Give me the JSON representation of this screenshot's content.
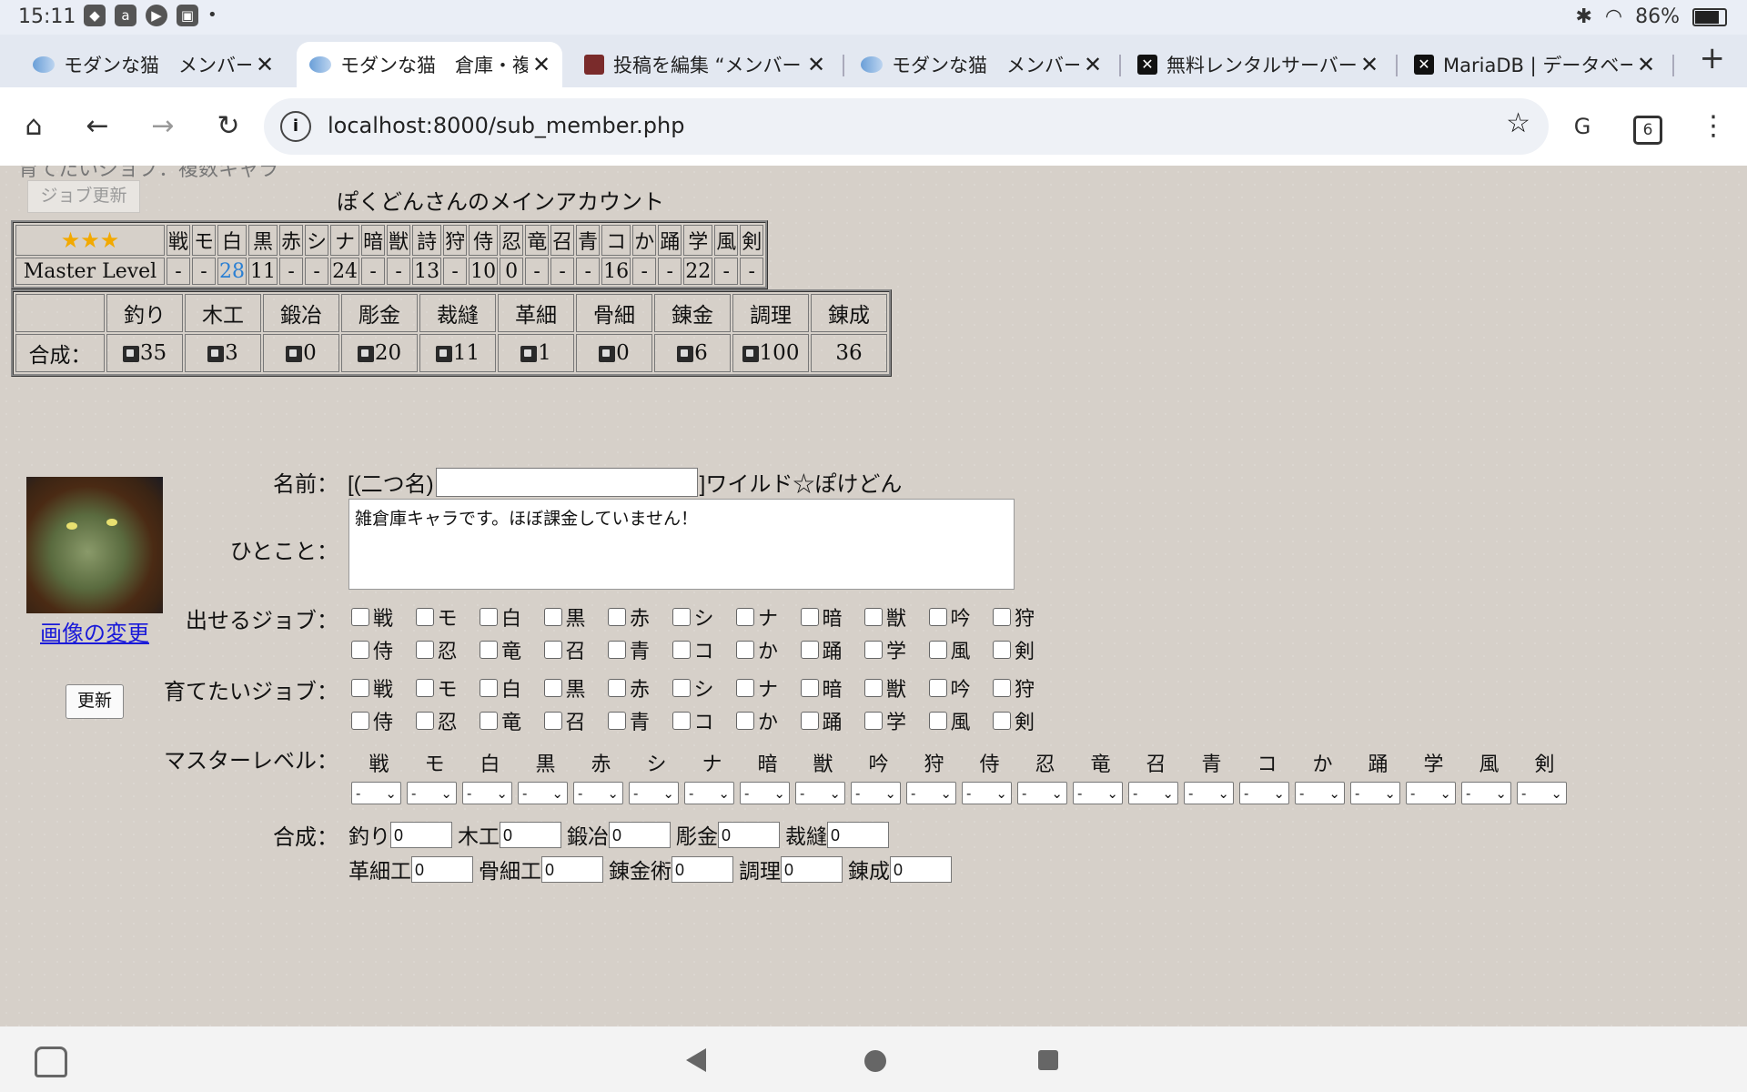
{
  "status": {
    "time": "15:11",
    "battery": "86%",
    "battery_level": 0.86,
    "icons": [
      "game-controller-icon",
      "amazon-icon",
      "play-icon",
      "media-icon"
    ]
  },
  "tabs": [
    {
      "title": "モダンな猫　メンバー",
      "icon": "cat-favicon"
    },
    {
      "title": "モダンな猫　倉庫・複",
      "icon": "cat-favicon"
    },
    {
      "title": "投稿を編集 “メンバー",
      "icon": "wordpress-favicon"
    },
    {
      "title": "モダンな猫　メンバー",
      "icon": "cat-favicon"
    },
    {
      "title": "無料レンタルサーバー",
      "icon": "x-favicon"
    },
    {
      "title": "MariaDB | データベース",
      "icon": "x-favicon"
    }
  ],
  "active_tab": 1,
  "toolbar": {
    "url": "localhost:8000/sub_member.php",
    "tab_count": "6"
  },
  "page": {
    "partial_text": "育てたいジョブ：複数キャラ",
    "job_update_button": "ジョブ更新",
    "account_title": "ぽくどんさんのメインアカウント",
    "stars": "★★★",
    "master_level_label": "Master Level",
    "jobs": [
      "戦",
      "モ",
      "白",
      "黒",
      "赤",
      "シ",
      "ナ",
      "暗",
      "獣",
      "詩",
      "狩",
      "侍",
      "忍",
      "竜",
      "召",
      "青",
      "コ",
      "か",
      "踊",
      "学",
      "風",
      "剣"
    ],
    "job_levels": [
      "-",
      "-",
      "28",
      "11",
      "-",
      "-",
      "24",
      "-",
      "-",
      "13",
      "-",
      "10",
      "0",
      "-",
      "-",
      "-",
      "16",
      "-",
      "-",
      "22",
      "-",
      "-"
    ],
    "highlight_job_index": 2,
    "craft_headers": [
      "釣り",
      "木工",
      "鍛冶",
      "彫金",
      "裁縫",
      "革細",
      "骨細",
      "錬金",
      "調理",
      "錬成"
    ],
    "craft_row_label": "合成：",
    "craft_values": [
      "35",
      "3",
      "0",
      "20",
      "11",
      "1",
      "0",
      "6",
      "100",
      "36"
    ],
    "image_change": "画像の変更",
    "update_button": "更新",
    "name_label": "名前：",
    "name_prefix": "[(二つ名)",
    "name_suffix": "]ワイルド☆ぽけどん",
    "comment_label": "ひとこと：",
    "comment": "雑倉庫キャラです。ほぼ課金していません！",
    "available_jobs_label": "出せるジョブ：",
    "train_jobs_label": "育てたいジョブ：",
    "job_checkbox_row1": [
      "戦",
      "モ",
      "白",
      "黒",
      "赤",
      "シ",
      "ナ",
      "暗",
      "獣",
      "吟",
      "狩"
    ],
    "job_checkbox_row2": [
      "侍",
      "忍",
      "竜",
      "召",
      "青",
      "コ",
      "か",
      "踊",
      "学",
      "風",
      "剣"
    ],
    "master_level_form_label": "マスターレベル：",
    "ml_jobs": [
      "戦",
      "モ",
      "白",
      "黒",
      "赤",
      "シ",
      "ナ",
      "暗",
      "獣",
      "吟",
      "狩",
      "侍",
      "忍",
      "竜",
      "召",
      "青",
      "コ",
      "か",
      "踊",
      "学",
      "風",
      "剣"
    ],
    "ml_select_value": "-",
    "craft_form_label": "合成：",
    "craft_form_row1": [
      {
        "label": "釣り",
        "value": "0"
      },
      {
        "label": "木工",
        "value": "0"
      },
      {
        "label": "鍛冶",
        "value": "0"
      },
      {
        "label": "彫金",
        "value": "0"
      },
      {
        "label": "裁縫",
        "value": "0"
      }
    ],
    "craft_form_row2": [
      {
        "label": "革細工",
        "value": "0"
      },
      {
        "label": "骨細工",
        "value": "0"
      },
      {
        "label": "錬金術",
        "value": "0"
      },
      {
        "label": "調理",
        "value": "0"
      },
      {
        "label": "錬成",
        "value": "0"
      }
    ]
  }
}
